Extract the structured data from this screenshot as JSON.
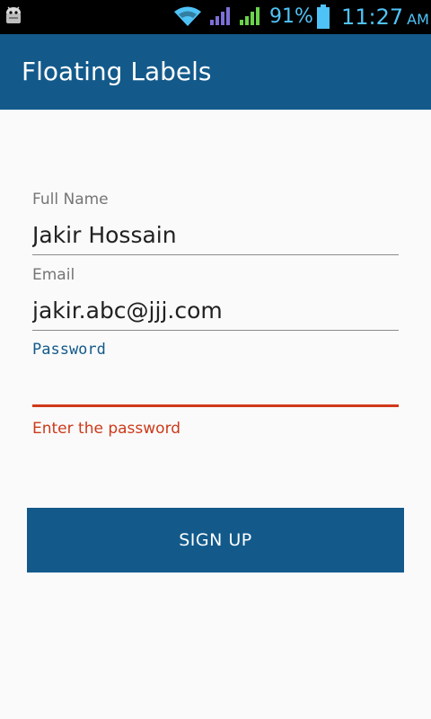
{
  "status_bar": {
    "battery_percent": "91%",
    "time": "11:27",
    "ampm": "AM",
    "icon_color": "#4fc3f7"
  },
  "app_bar": {
    "title": "Floating Labels",
    "background": "#135a8b"
  },
  "form": {
    "full_name": {
      "label": "Full Name",
      "value": "Jakir Hossain"
    },
    "email": {
      "label": "Email",
      "value": "jakir.abc@jjj.com"
    },
    "password": {
      "label": "Password",
      "value": "",
      "error": "Enter the password",
      "error_color": "#cc3a1a"
    },
    "signup_label": "SIGN UP"
  }
}
